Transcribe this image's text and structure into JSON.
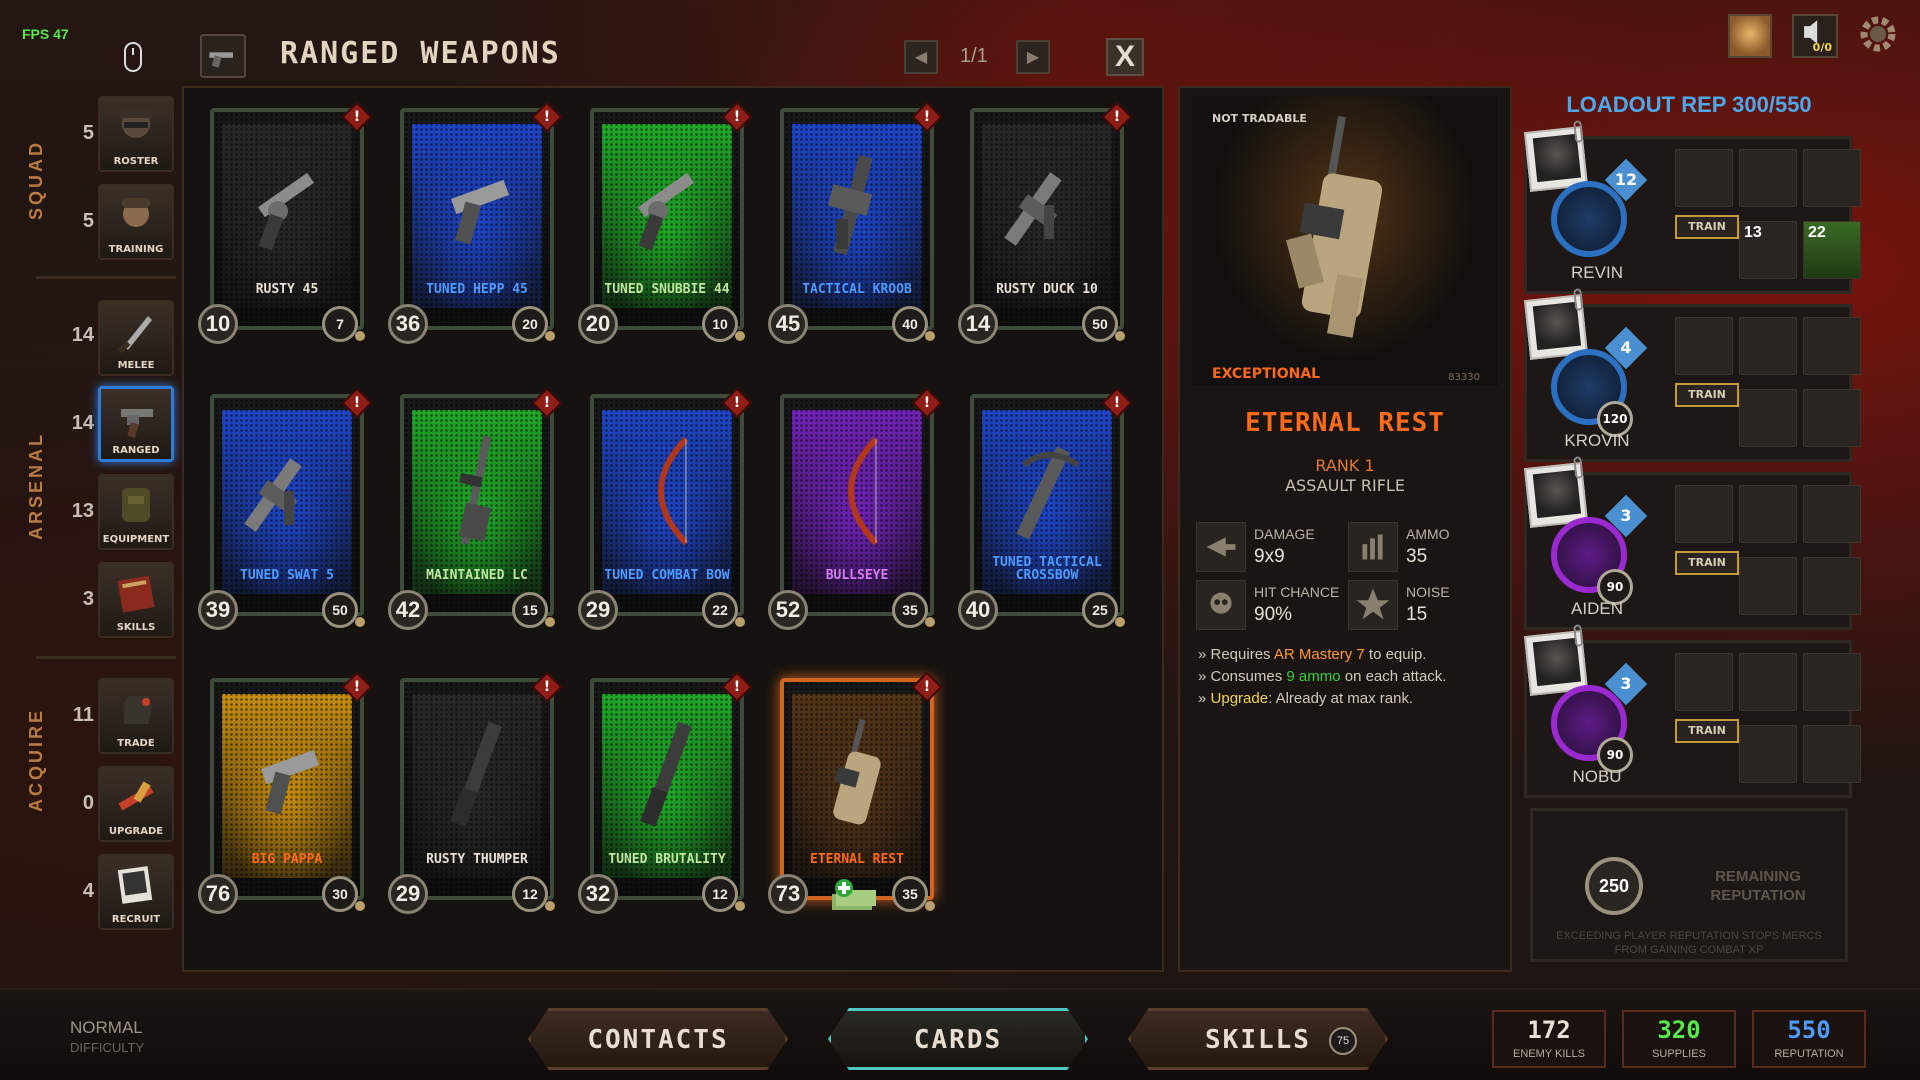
{
  "fps": "FPS 47",
  "header": {
    "title": "RANGED WEAPONS",
    "page": "1/1",
    "prev_icon": "◀",
    "next_icon": "▶",
    "close": "X"
  },
  "sidebar": {
    "groups": [
      {
        "label": "SQUAD"
      },
      {
        "label": "ARSENAL"
      },
      {
        "label": "ACQUIRE"
      }
    ],
    "items": [
      {
        "count": "5",
        "label": "ROSTER"
      },
      {
        "count": "5",
        "label": "TRAINING"
      },
      {
        "count": "14",
        "label": "MELEE"
      },
      {
        "count": "14",
        "label": "RANGED"
      },
      {
        "count": "13",
        "label": "EQUIPMENT"
      },
      {
        "count": "3",
        "label": "SKILLS"
      },
      {
        "count": "11",
        "label": "TRADE"
      },
      {
        "count": "0",
        "label": "UPGRADE"
      },
      {
        "count": "4",
        "label": "RECRUIT"
      }
    ]
  },
  "cards": [
    {
      "name": "RUSTY 45",
      "rep": "10",
      "ammo": "7",
      "badge": "!",
      "glow": "#2a2a2a",
      "text_color": "#e6e0d6",
      "weapon": "revolver-icon"
    },
    {
      "name": "TUNED HEPP 45",
      "rep": "36",
      "ammo": "20",
      "badge": "!",
      "glow": "#1f4ad8",
      "text_color": "#4f9aff",
      "weapon": "pistol-icon"
    },
    {
      "name": "TUNED SNUBBIE 44",
      "rep": "20",
      "ammo": "10",
      "badge": "!",
      "glow": "#21b82a",
      "text_color": "#bfe6a0",
      "weapon": "revolver-icon"
    },
    {
      "name": "TACTICAL KROOB",
      "rep": "45",
      "ammo": "40",
      "badge": "!",
      "glow": "#1f4ad8",
      "text_color": "#4f9aff",
      "weapon": "rifle-icon"
    },
    {
      "name": "RUSTY DUCK 10",
      "rep": "14",
      "ammo": "50",
      "badge": "!",
      "glow": "#2a2a2a",
      "text_color": "#e6e0d6",
      "weapon": "smg-icon"
    },
    {
      "name": "TUNED SWAT 5",
      "rep": "39",
      "ammo": "50",
      "badge": "!",
      "glow": "#1f4ad8",
      "text_color": "#4f9aff",
      "weapon": "smg-icon"
    },
    {
      "name": "MAINTAINED LC",
      "rep": "42",
      "ammo": "15",
      "badge": "!",
      "glow": "#21b82a",
      "text_color": "#bfe6a0",
      "weapon": "sniper-icon"
    },
    {
      "name": "TUNED COMBAT BOW",
      "rep": "29",
      "ammo": "22",
      "badge": "!",
      "glow": "#1f4ad8",
      "text_color": "#4f9aff",
      "weapon": "bow-icon"
    },
    {
      "name": "BULLSEYE",
      "rep": "52",
      "ammo": "35",
      "badge": "!",
      "glow": "#7a24c8",
      "text_color": "#d27ef2",
      "weapon": "bow-icon"
    },
    {
      "name": "TUNED TACTICAL CROSSBOW",
      "rep": "40",
      "ammo": "25",
      "badge": "!",
      "glow": "#1f4ad8",
      "text_color": "#4f9aff",
      "weapon": "crossbow-icon"
    },
    {
      "name": "BIG PAPPA",
      "rep": "76",
      "ammo": "30",
      "badge": "!",
      "glow": "#d89a10",
      "text_color": "#ff6a1a",
      "weapon": "pistol-icon"
    },
    {
      "name": "RUSTY THUMPER",
      "rep": "29",
      "ammo": "12",
      "badge": "!",
      "glow": "#2a2a2a",
      "text_color": "#e6e0d6",
      "weapon": "shotgun-icon"
    },
    {
      "name": "TUNED BRUTALITY",
      "rep": "32",
      "ammo": "12",
      "badge": "!",
      "glow": "#21b82a",
      "text_color": "#bfe6a0",
      "weapon": "shotgun-icon"
    },
    {
      "name": "ETERNAL REST",
      "rep": "73",
      "ammo": "35",
      "badge": "!",
      "glow": "#5a3818",
      "text_color": "#ff6a1a",
      "weapon": "assault-rifle-icon",
      "selected": true
    }
  ],
  "detail": {
    "tradable": "NOT TRADABLE",
    "rarity": "EXCEPTIONAL",
    "serial": "83330",
    "name": "ETERNAL REST",
    "rank": "RANK 1",
    "class": "ASSAULT RIFLE",
    "stats": [
      {
        "label": "DAMAGE",
        "value": "9x9",
        "icon": "damage-icon"
      },
      {
        "label": "AMMO",
        "value": "35",
        "icon": "ammo-icon"
      },
      {
        "label": "HIT CHANCE",
        "value": "90%",
        "icon": "hit-chance-icon"
      },
      {
        "label": "NOISE",
        "value": "15",
        "icon": "noise-icon"
      }
    ],
    "notes": {
      "n1_pre": "» Requires ",
      "n1_hl": "AR Mastery 7",
      "n1_post": " to equip.",
      "n2_pre": "» Consumes ",
      "n2_hl": "9",
      "n2_mid": " ammo",
      "n2_post": " on each attack.",
      "n3_pre": "» ",
      "n3_hl": "Upgrade",
      "n3_post": ": Already at max rank."
    }
  },
  "loadout": {
    "title": "LOADOUT REP 300/550",
    "mercs": [
      {
        "name": "REVIN",
        "level": "12",
        "xp": "",
        "train": "TRAIN",
        "slot_a": "13",
        "slot_b": "22"
      },
      {
        "name": "KROVIN",
        "level": "4",
        "xp": "120",
        "train": "TRAIN"
      },
      {
        "name": "AIDEN",
        "level": "3",
        "xp": "90",
        "train": "TRAIN"
      },
      {
        "name": "NOBU",
        "level": "3",
        "xp": "90",
        "train": "TRAIN"
      }
    ],
    "remaining_value": "250",
    "remaining_label": "REMAINING REPUTATION",
    "remaining_note": "EXCEEDING PLAYER REPUTATION STOPS MERCS FROM GAINING COMBAT XP"
  },
  "topbar": {
    "sound": "0/0"
  },
  "bottom": {
    "difficulty": "NORMAL",
    "difficulty_label": "DIFFICULTY",
    "buttons": {
      "contacts": "CONTACTS",
      "cards": "CARDS",
      "skills": "SKILLS",
      "skills_count": "75"
    },
    "counters": [
      {
        "value": "172",
        "label": "ENEMY KILLS",
        "color": "#e6e0d6"
      },
      {
        "value": "320",
        "label": "SUPPLIES",
        "color": "#58e84c"
      },
      {
        "value": "550",
        "label": "REPUTATION",
        "color": "#4f9aff"
      }
    ]
  },
  "colors": {
    "accent_orange": "#ff6a1a",
    "loadout_blue": "#4fa7e8",
    "selected_nav": "#2f7cd8"
  }
}
